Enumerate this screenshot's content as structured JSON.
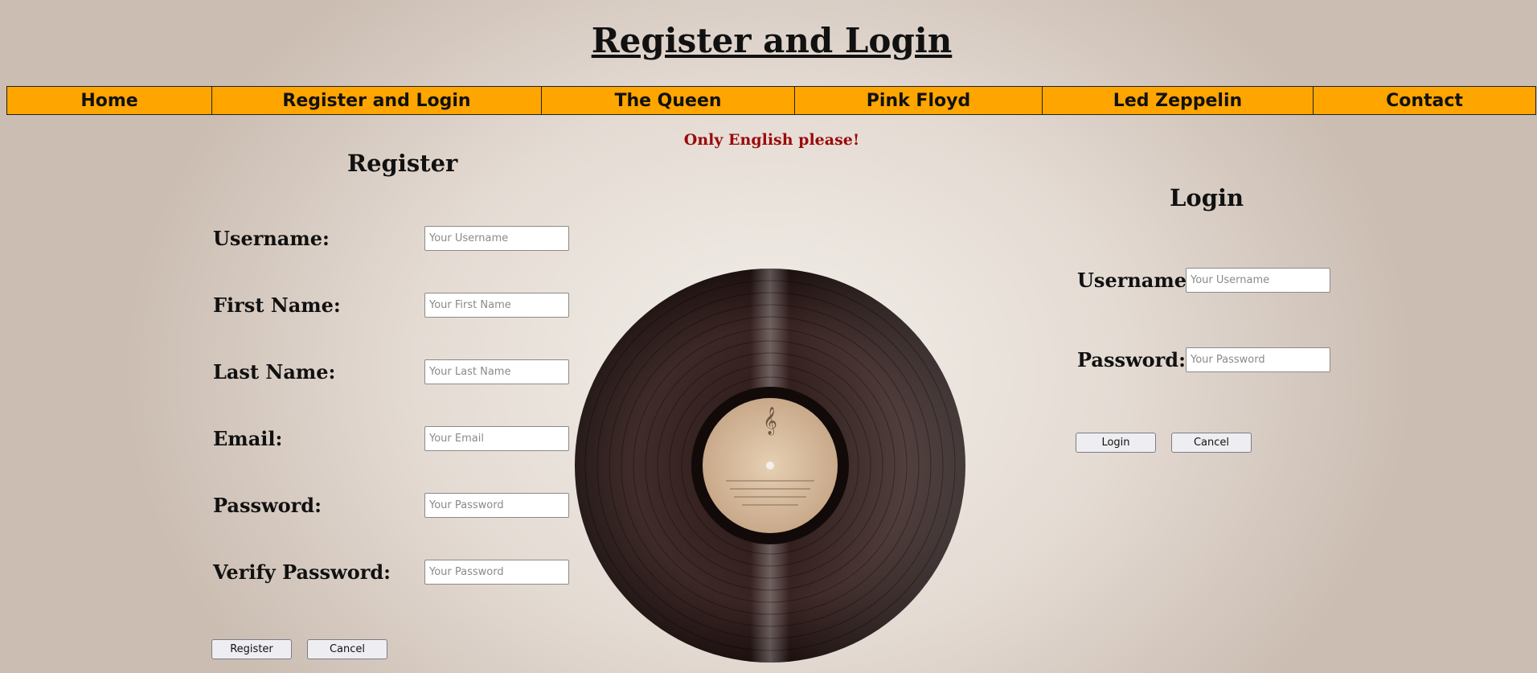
{
  "page": {
    "title": "Register and Login",
    "notice": "Only English please!"
  },
  "nav": {
    "items": [
      "Home",
      "Register and Login",
      "The Queen",
      "Pink Floyd",
      "Led Zeppelin",
      "Contact"
    ]
  },
  "register": {
    "heading": "Register",
    "fields": [
      {
        "label": "Username:",
        "placeholder": "Your Username"
      },
      {
        "label": "First Name:",
        "placeholder": "Your First Name"
      },
      {
        "label": "Last Name:",
        "placeholder": "Your Last Name"
      },
      {
        "label": "Email:",
        "placeholder": "Your Email"
      },
      {
        "label": "Password:",
        "placeholder": "Your Password"
      },
      {
        "label": "Verify Password:",
        "placeholder": "Your Password"
      }
    ],
    "submit_label": "Register",
    "cancel_label": "Cancel"
  },
  "login": {
    "heading": "Login",
    "fields": [
      {
        "label": "Username:",
        "placeholder": "Your Username"
      },
      {
        "label": "Password:",
        "placeholder": "Your Password"
      }
    ],
    "submit_label": "Login",
    "cancel_label": "Cancel"
  },
  "colors": {
    "nav_bg": "#ffa500",
    "notice": "#9a0a0a"
  }
}
